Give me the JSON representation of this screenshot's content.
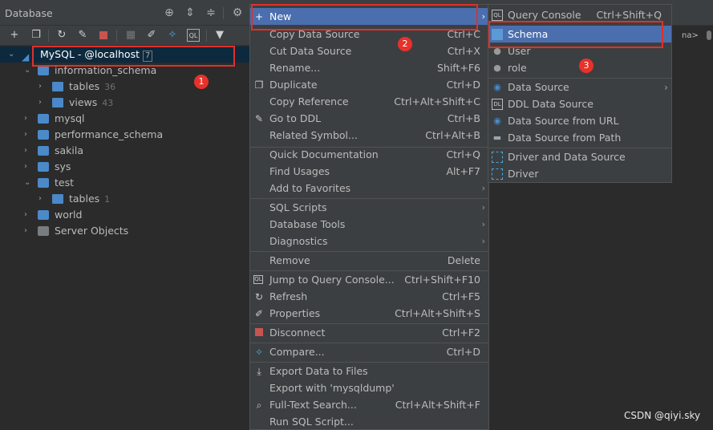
{
  "panel": {
    "title": "Database"
  },
  "tree": {
    "root": {
      "label": "MySQL - @localhost",
      "badge": "7"
    },
    "items": [
      {
        "label": "information_schema"
      },
      {
        "label": "tables",
        "count": "36"
      },
      {
        "label": "views",
        "count": "43"
      },
      {
        "label": "mysql"
      },
      {
        "label": "performance_schema"
      },
      {
        "label": "sakila"
      },
      {
        "label": "sys"
      },
      {
        "label": "test"
      },
      {
        "label": "tables",
        "count": "1"
      },
      {
        "label": "world"
      },
      {
        "label": "Server Objects"
      }
    ]
  },
  "context_menu": {
    "items": [
      {
        "label": "New",
        "shortcut": ""
      },
      {
        "label": "Copy Data Source",
        "shortcut": "Ctrl+C"
      },
      {
        "label": "Cut Data Source",
        "shortcut": "Ctrl+X"
      },
      {
        "label": "Rename...",
        "shortcut": "Shift+F6"
      },
      {
        "label": "Duplicate",
        "shortcut": "Ctrl+D"
      },
      {
        "label": "Copy Reference",
        "shortcut": "Ctrl+Alt+Shift+C"
      },
      {
        "label": "Go to DDL",
        "shortcut": "Ctrl+B"
      },
      {
        "label": "Related Symbol...",
        "shortcut": "Ctrl+Alt+B"
      },
      {
        "label": "Quick Documentation",
        "shortcut": "Ctrl+Q"
      },
      {
        "label": "Find Usages",
        "shortcut": "Alt+F7"
      },
      {
        "label": "Add to Favorites",
        "shortcut": ""
      },
      {
        "label": "SQL Scripts",
        "shortcut": ""
      },
      {
        "label": "Database Tools",
        "shortcut": ""
      },
      {
        "label": "Diagnostics",
        "shortcut": ""
      },
      {
        "label": "Remove",
        "shortcut": "Delete"
      },
      {
        "label": "Jump to Query Console...",
        "shortcut": "Ctrl+Shift+F10"
      },
      {
        "label": "Refresh",
        "shortcut": "Ctrl+F5"
      },
      {
        "label": "Properties",
        "shortcut": "Ctrl+Alt+Shift+S"
      },
      {
        "label": "Disconnect",
        "shortcut": "Ctrl+F2"
      },
      {
        "label": "Compare...",
        "shortcut": "Ctrl+D"
      },
      {
        "label": "Export Data to Files",
        "shortcut": ""
      },
      {
        "label": "Export with 'mysqldump'",
        "shortcut": ""
      },
      {
        "label": "Full-Text Search...",
        "shortcut": "Ctrl+Alt+Shift+F"
      },
      {
        "label": "Run SQL Script...",
        "shortcut": ""
      }
    ]
  },
  "new_submenu": {
    "items": [
      {
        "label": "Query Console",
        "shortcut": "Ctrl+Shift+Q"
      },
      {
        "label": "Schema",
        "shortcut": ""
      },
      {
        "label": "User",
        "shortcut": ""
      },
      {
        "label": "role",
        "shortcut": ""
      },
      {
        "label": "Data Source",
        "shortcut": ""
      },
      {
        "label": "DDL Data Source",
        "shortcut": ""
      },
      {
        "label": "Data Source from URL",
        "shortcut": ""
      },
      {
        "label": "Data Source from Path",
        "shortcut": ""
      },
      {
        "label": "Driver and Data Source",
        "shortcut": ""
      },
      {
        "label": "Driver",
        "shortcut": ""
      }
    ]
  },
  "annotations": {
    "one": "1",
    "two": "2",
    "three": "3"
  },
  "editor_fragment": "na>",
  "watermark": "CSDN @qiyi.sky",
  "colors": {
    "selection": "#4b6eaf",
    "annotation": "#e0302a",
    "background": "#2b2b2b"
  }
}
